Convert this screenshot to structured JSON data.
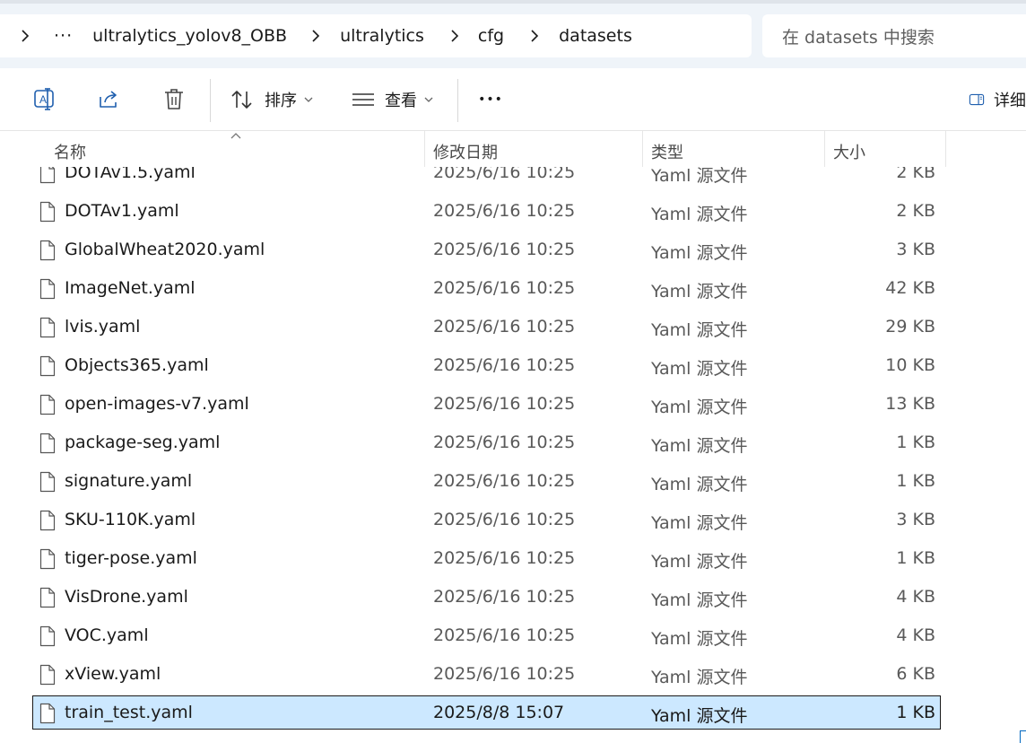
{
  "address_bar": {
    "overflow": "···",
    "crumbs": [
      "ultralytics_yolov8_OBB",
      "ultralytics",
      "cfg",
      "datasets"
    ]
  },
  "search": {
    "placeholder": "在 datasets 中搜索"
  },
  "toolbar": {
    "sort_label": "排序",
    "view_label": "查看",
    "more_label": "•••",
    "details_label": "详细"
  },
  "columns": {
    "name": "名称",
    "date": "修改日期",
    "type": "类型",
    "size": "大小"
  },
  "files": [
    {
      "name": "DOTAv1.5.yaml",
      "date": "2025/6/16 10:25",
      "type": "Yaml 源文件",
      "size": "2 KB"
    },
    {
      "name": "DOTAv1.yaml",
      "date": "2025/6/16 10:25",
      "type": "Yaml 源文件",
      "size": "2 KB"
    },
    {
      "name": "GlobalWheat2020.yaml",
      "date": "2025/6/16 10:25",
      "type": "Yaml 源文件",
      "size": "3 KB"
    },
    {
      "name": "ImageNet.yaml",
      "date": "2025/6/16 10:25",
      "type": "Yaml 源文件",
      "size": "42 KB"
    },
    {
      "name": "lvis.yaml",
      "date": "2025/6/16 10:25",
      "type": "Yaml 源文件",
      "size": "29 KB"
    },
    {
      "name": "Objects365.yaml",
      "date": "2025/6/16 10:25",
      "type": "Yaml 源文件",
      "size": "10 KB"
    },
    {
      "name": "open-images-v7.yaml",
      "date": "2025/6/16 10:25",
      "type": "Yaml 源文件",
      "size": "13 KB"
    },
    {
      "name": "package-seg.yaml",
      "date": "2025/6/16 10:25",
      "type": "Yaml 源文件",
      "size": "1 KB"
    },
    {
      "name": "signature.yaml",
      "date": "2025/6/16 10:25",
      "type": "Yaml 源文件",
      "size": "1 KB"
    },
    {
      "name": "SKU-110K.yaml",
      "date": "2025/6/16 10:25",
      "type": "Yaml 源文件",
      "size": "3 KB"
    },
    {
      "name": "tiger-pose.yaml",
      "date": "2025/6/16 10:25",
      "type": "Yaml 源文件",
      "size": "1 KB"
    },
    {
      "name": "VisDrone.yaml",
      "date": "2025/6/16 10:25",
      "type": "Yaml 源文件",
      "size": "4 KB"
    },
    {
      "name": "VOC.yaml",
      "date": "2025/6/16 10:25",
      "type": "Yaml 源文件",
      "size": "4 KB"
    },
    {
      "name": "xView.yaml",
      "date": "2025/6/16 10:25",
      "type": "Yaml 源文件",
      "size": "6 KB"
    },
    {
      "name": "train_test.yaml",
      "date": "2025/8/8 15:07",
      "type": "Yaml 源文件",
      "size": "1 KB",
      "selected": true
    }
  ],
  "colors": {
    "selection": "#cce8ff",
    "address_bg": "#eff4f9",
    "accent": "#0067c0"
  }
}
